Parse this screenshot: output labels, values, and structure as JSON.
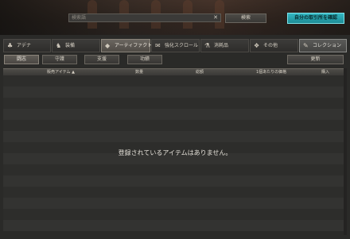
{
  "header": {
    "search_placeholder": "検索語",
    "search_clear_icon": "close-icon",
    "search_button_label": "検索",
    "my_market_button_label": "自分の取引所を確認"
  },
  "tabs": [
    {
      "label": "アデナ",
      "icon": "adena-icon",
      "icon_glyph": "♣"
    },
    {
      "label": "装備",
      "icon": "equipment-icon",
      "icon_glyph": "♞"
    },
    {
      "label": "アーティファクト",
      "icon": "artifact-icon",
      "icon_glyph": "◆"
    },
    {
      "label": "強化スクロール",
      "icon": "scroll-icon",
      "icon_glyph": "✉"
    },
    {
      "label": "消耗品",
      "icon": "potion-icon",
      "icon_glyph": "⚗"
    },
    {
      "label": "その他",
      "icon": "box-icon",
      "icon_glyph": "❖"
    },
    {
      "label": "コレクション",
      "icon": "collection-icon",
      "icon_glyph": "✎"
    }
  ],
  "active_tab": "アーティファクト",
  "subcategories": [
    "闘志",
    "守護",
    "支援",
    "功績"
  ],
  "active_subcategory": "闘志",
  "refresh_label": "更新",
  "table": {
    "columns": [
      "販売アイテム ▲",
      "数量",
      "総額",
      "1個あたりの価格",
      "購入"
    ]
  },
  "empty_message": "登録されているアイテムはありません。"
}
